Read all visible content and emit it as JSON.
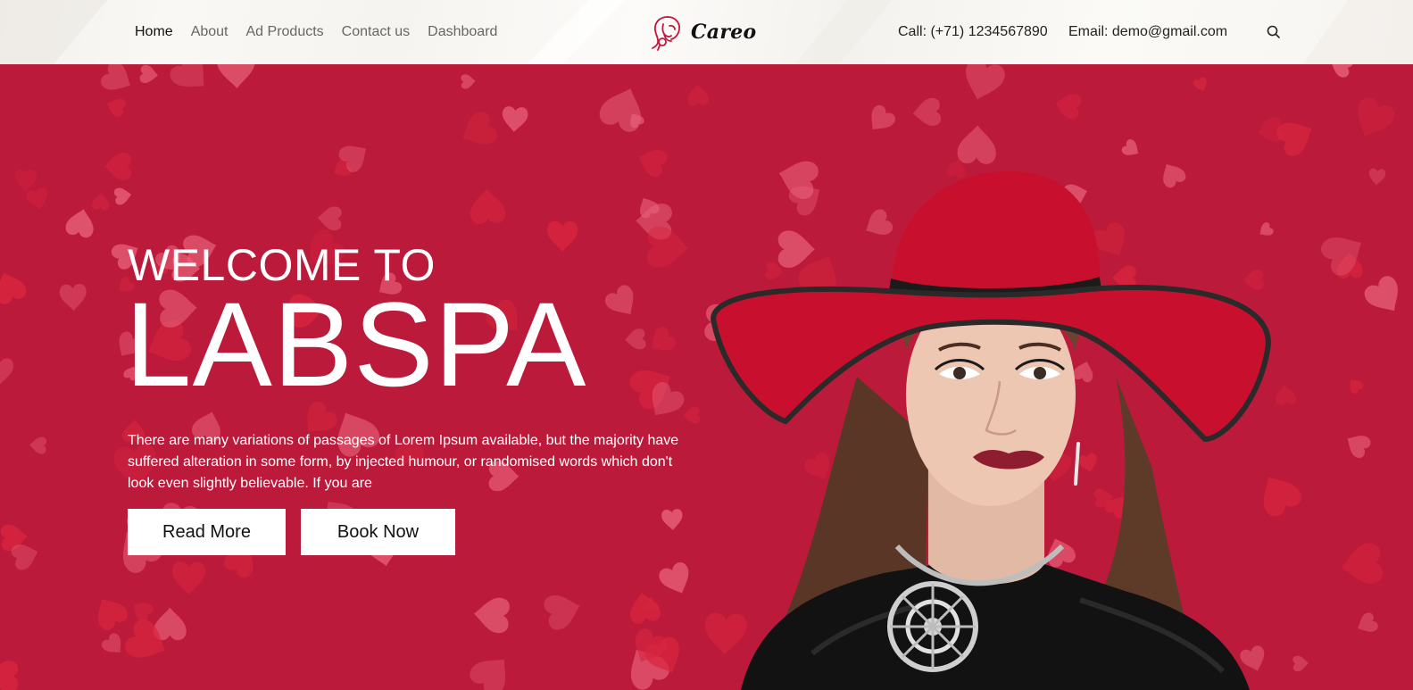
{
  "nav": {
    "items": [
      {
        "label": "Home",
        "active": true
      },
      {
        "label": "About",
        "active": false
      },
      {
        "label": "Ad Products",
        "active": false
      },
      {
        "label": "Contact us",
        "active": false
      },
      {
        "label": "Dashboard",
        "active": false
      }
    ]
  },
  "logo": {
    "text": "Careo",
    "icon": "woman-face-icon"
  },
  "contact": {
    "call": "Call: (+71) 1234567890",
    "email": "Email: demo@gmail.com"
  },
  "search": {
    "icon": "search-icon"
  },
  "hero": {
    "welcome": "WELCOME TO",
    "brand": "LABSPA",
    "description": "There are many variations of passages of Lorem Ipsum available, but the majority have suffered alteration in some form, by injected humour, or randomised words which don't look even slightly believable. If you are",
    "read_more": "Read More",
    "book_now": "Book Now",
    "background_pattern": "hearts-pattern",
    "image": "woman-in-red-hat"
  },
  "colors": {
    "hero_bg": "#bc1a3a",
    "accent": "#c0183a",
    "header_bg": "#f6f4f0"
  }
}
